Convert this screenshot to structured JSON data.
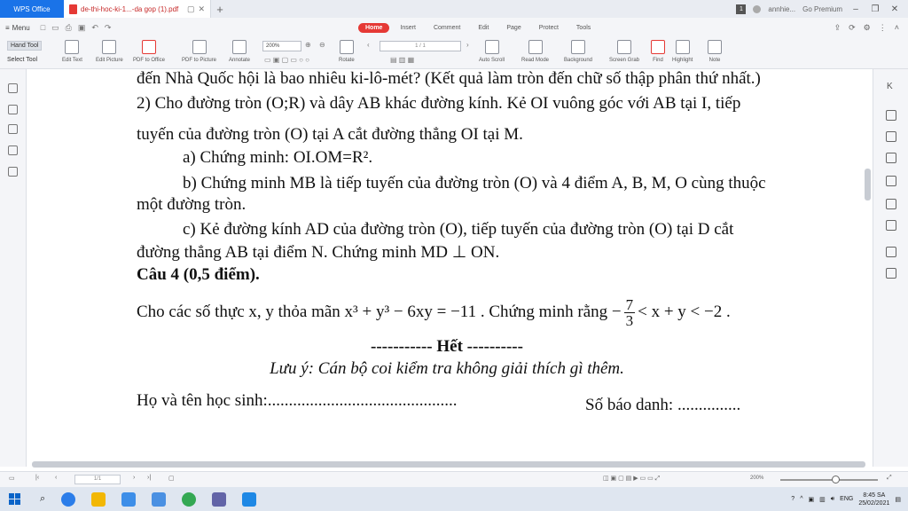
{
  "titlebar": {
    "app_name": "WPS Office",
    "doc_tab_title": "de-thi-hoc-ki-1...-da gop (1).pdf",
    "badge": "1",
    "user": "annhie...",
    "premium": "Go Premium"
  },
  "menubar": {
    "menu_label": "Menu",
    "tabs": [
      "Home",
      "Insert",
      "Comment",
      "Edit",
      "Page",
      "Protect",
      "Tools"
    ]
  },
  "toolbar": {
    "hand_tool": "Hand Tool",
    "select_tool": "Select Tool",
    "zoom_value": "200%",
    "page_value": "1 / 1",
    "items": [
      {
        "label": "Edit Text",
        "icon": "edit-text-icon"
      },
      {
        "label": "Edit Picture",
        "icon": "edit-picture-icon"
      },
      {
        "label": "PDF to Office",
        "icon": "pdf-to-office-icon"
      },
      {
        "label": "PDF to Picture",
        "icon": "pdf-to-picture-icon"
      },
      {
        "label": "Annotate",
        "icon": "annotate-icon"
      },
      {
        "label": "Rotate",
        "icon": "rotate-icon"
      },
      {
        "label": "Auto Scroll",
        "icon": "auto-scroll-icon"
      },
      {
        "label": "Read Mode",
        "icon": "read-mode-icon"
      },
      {
        "label": "Background",
        "icon": "background-icon"
      },
      {
        "label": "Screen Grab",
        "icon": "screen-grab-icon"
      },
      {
        "label": "Find",
        "icon": "find-icon"
      },
      {
        "label": "Highlight",
        "icon": "highlight-icon"
      },
      {
        "label": "Note",
        "icon": "note-icon"
      }
    ]
  },
  "document": {
    "line0": "đến Nhà Quốc hội là bao nhiêu ki-lô-mét? (Kết quả làm tròn đến chữ số thập phân thứ nhất.)",
    "line1": "2) Cho đường tròn (O;R) và dây AB khác đường kính. Kẻ OI vuông góc với AB tại I, tiếp",
    "line2": "tuyến của đường tròn (O) tại A cắt đường thẳng OI tại M.",
    "line3": "a)  Chứng minh: OI.OM=R².",
    "line4": "b)  Chứng minh MB là tiếp tuyến của đường tròn (O) và 4 điểm A, B, M, O cùng thuộc",
    "line5": "một đường tròn.",
    "line6": "c)  Kẻ đường kính AD của đường tròn (O), tiếp tuyến của đường tròn (O) tại D cắt",
    "line7": "đường thẳng AB tại điểm N. Chứng minh MD ⊥ ON.",
    "heading": "Câu 4 (0,5 điểm).",
    "line9_a": "Cho các số thực x, y thỏa mãn  x³ + y³ − 6xy = −11 . Chứng minh rằng  −",
    "frac_num": "7",
    "frac_den": "3",
    "line9_b": "< x + y < −2 .",
    "end": "----------- Hết ----------",
    "note": "Lưu ý: Cán bộ coi kiểm tra không giải thích gì thêm.",
    "footer_left": "Họ và tên học sinh:.............................................",
    "footer_right": "Số báo danh: ..............."
  },
  "statusbar": {
    "page": "1/1",
    "zoom": "200%"
  },
  "taskbar": {
    "lang": "ENG",
    "time": "8:45 SA",
    "date": "25/02/2021"
  }
}
